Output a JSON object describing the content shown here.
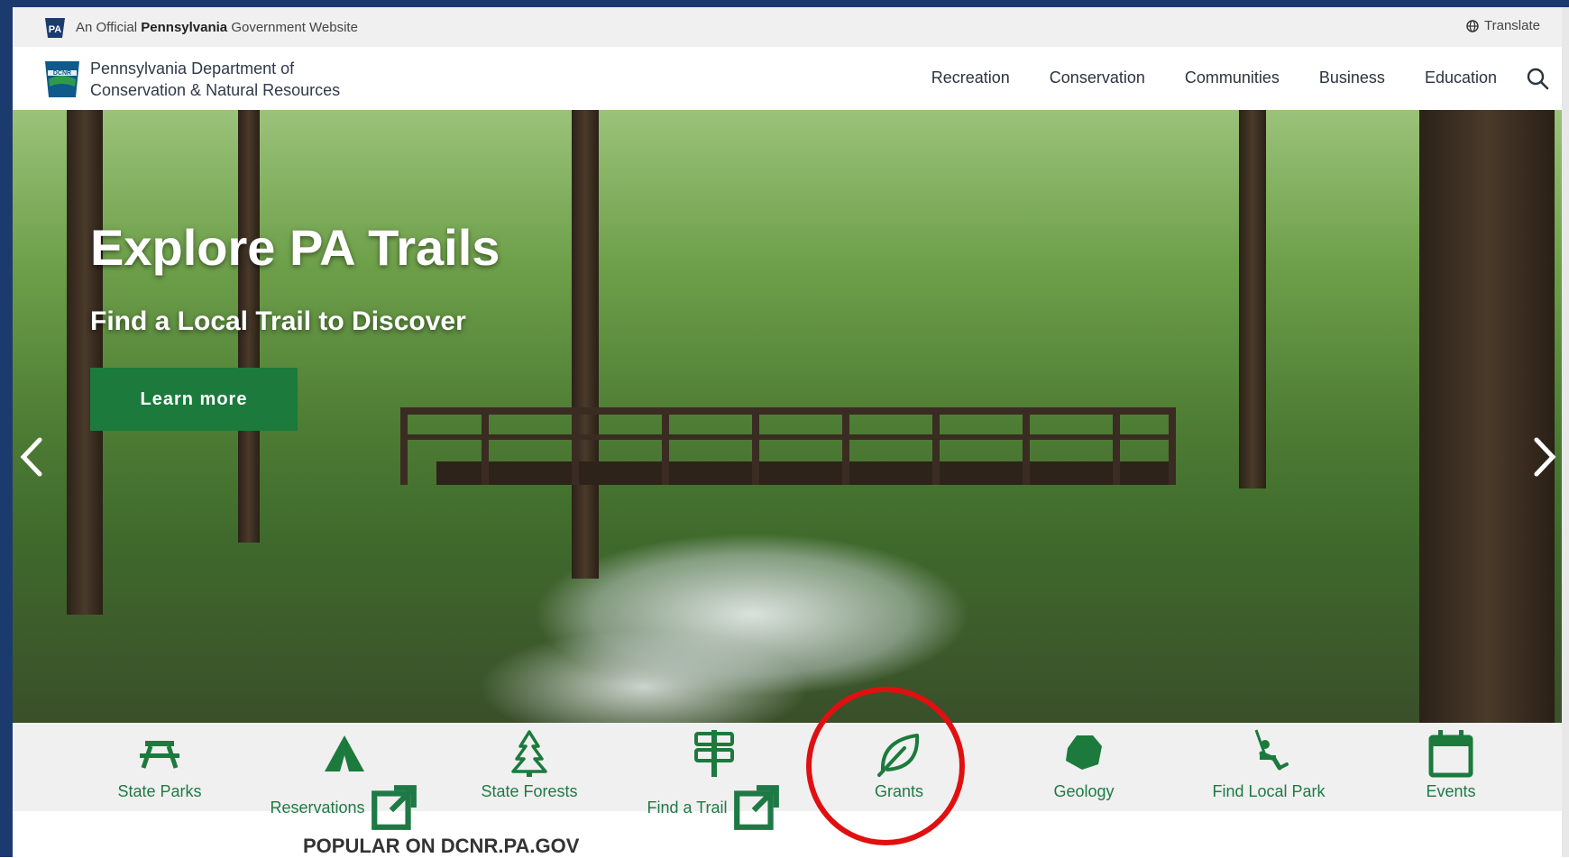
{
  "official_bar": {
    "badge": "PA",
    "text_prefix": "An Official ",
    "text_bold": "Pennsylvania",
    "text_suffix": " Government Website",
    "translate_label": "Translate",
    "translate_icon": "globe-icon"
  },
  "header": {
    "logo_icon": "dcnr-logo",
    "dept_line1": "Pennsylvania Department of",
    "dept_line2": "Conservation & Natural Resources",
    "menu": [
      "Recreation",
      "Conservation",
      "Communities",
      "Business",
      "Education"
    ],
    "search_icon": "search-icon"
  },
  "hero": {
    "title": "Explore PA Trails",
    "subtitle": "Find a Local Trail to Discover",
    "button_label": "Learn more",
    "prev_icon": "chevron-left-icon",
    "next_icon": "chevron-right-icon"
  },
  "quick_links": [
    {
      "label": "State Parks",
      "icon": "picnic-table-icon",
      "external": false
    },
    {
      "label": "Reservations",
      "icon": "tent-icon",
      "external": true
    },
    {
      "label": "State Forests",
      "icon": "pine-tree-icon",
      "external": false
    },
    {
      "label": "Find a Trail",
      "icon": "signpost-icon",
      "external": true
    },
    {
      "label": "Grants",
      "icon": "leaf-icon",
      "external": false
    },
    {
      "label": "Geology",
      "icon": "rock-icon",
      "external": false
    },
    {
      "label": "Find Local Park",
      "icon": "playground-swing-icon",
      "external": false
    },
    {
      "label": "Events",
      "icon": "calendar-icon",
      "external": false
    }
  ],
  "popular_heading": "POPULAR ON DCNR.PA.GOV",
  "colors": {
    "brand_green": "#1b7a3c",
    "highlight_circle": "#e01010",
    "frame_blue": "#1b3b6f"
  }
}
